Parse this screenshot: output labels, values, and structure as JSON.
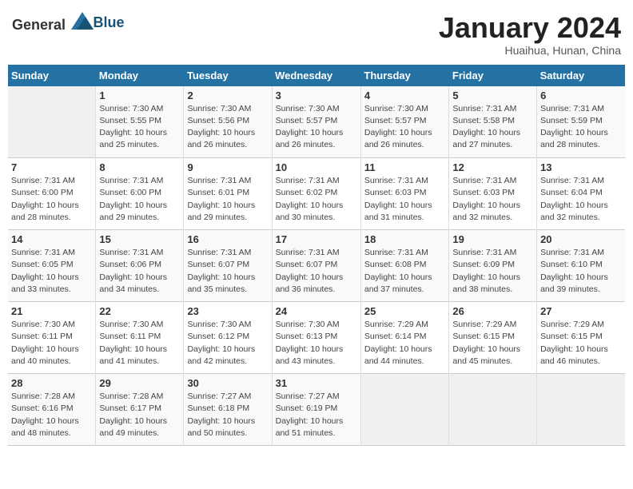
{
  "header": {
    "logo_general": "General",
    "logo_blue": "Blue",
    "month_title": "January 2024",
    "location": "Huaihua, Hunan, China"
  },
  "weekdays": [
    "Sunday",
    "Monday",
    "Tuesday",
    "Wednesday",
    "Thursday",
    "Friday",
    "Saturday"
  ],
  "weeks": [
    [
      {
        "day": "",
        "info": ""
      },
      {
        "day": "1",
        "info": "Sunrise: 7:30 AM\nSunset: 5:55 PM\nDaylight: 10 hours\nand 25 minutes."
      },
      {
        "day": "2",
        "info": "Sunrise: 7:30 AM\nSunset: 5:56 PM\nDaylight: 10 hours\nand 26 minutes."
      },
      {
        "day": "3",
        "info": "Sunrise: 7:30 AM\nSunset: 5:57 PM\nDaylight: 10 hours\nand 26 minutes."
      },
      {
        "day": "4",
        "info": "Sunrise: 7:30 AM\nSunset: 5:57 PM\nDaylight: 10 hours\nand 26 minutes."
      },
      {
        "day": "5",
        "info": "Sunrise: 7:31 AM\nSunset: 5:58 PM\nDaylight: 10 hours\nand 27 minutes."
      },
      {
        "day": "6",
        "info": "Sunrise: 7:31 AM\nSunset: 5:59 PM\nDaylight: 10 hours\nand 28 minutes."
      }
    ],
    [
      {
        "day": "7",
        "info": "Sunrise: 7:31 AM\nSunset: 6:00 PM\nDaylight: 10 hours\nand 28 minutes."
      },
      {
        "day": "8",
        "info": "Sunrise: 7:31 AM\nSunset: 6:00 PM\nDaylight: 10 hours\nand 29 minutes."
      },
      {
        "day": "9",
        "info": "Sunrise: 7:31 AM\nSunset: 6:01 PM\nDaylight: 10 hours\nand 29 minutes."
      },
      {
        "day": "10",
        "info": "Sunrise: 7:31 AM\nSunset: 6:02 PM\nDaylight: 10 hours\nand 30 minutes."
      },
      {
        "day": "11",
        "info": "Sunrise: 7:31 AM\nSunset: 6:03 PM\nDaylight: 10 hours\nand 31 minutes."
      },
      {
        "day": "12",
        "info": "Sunrise: 7:31 AM\nSunset: 6:03 PM\nDaylight: 10 hours\nand 32 minutes."
      },
      {
        "day": "13",
        "info": "Sunrise: 7:31 AM\nSunset: 6:04 PM\nDaylight: 10 hours\nand 32 minutes."
      }
    ],
    [
      {
        "day": "14",
        "info": "Sunrise: 7:31 AM\nSunset: 6:05 PM\nDaylight: 10 hours\nand 33 minutes."
      },
      {
        "day": "15",
        "info": "Sunrise: 7:31 AM\nSunset: 6:06 PM\nDaylight: 10 hours\nand 34 minutes."
      },
      {
        "day": "16",
        "info": "Sunrise: 7:31 AM\nSunset: 6:07 PM\nDaylight: 10 hours\nand 35 minutes."
      },
      {
        "day": "17",
        "info": "Sunrise: 7:31 AM\nSunset: 6:07 PM\nDaylight: 10 hours\nand 36 minutes."
      },
      {
        "day": "18",
        "info": "Sunrise: 7:31 AM\nSunset: 6:08 PM\nDaylight: 10 hours\nand 37 minutes."
      },
      {
        "day": "19",
        "info": "Sunrise: 7:31 AM\nSunset: 6:09 PM\nDaylight: 10 hours\nand 38 minutes."
      },
      {
        "day": "20",
        "info": "Sunrise: 7:31 AM\nSunset: 6:10 PM\nDaylight: 10 hours\nand 39 minutes."
      }
    ],
    [
      {
        "day": "21",
        "info": "Sunrise: 7:30 AM\nSunset: 6:11 PM\nDaylight: 10 hours\nand 40 minutes."
      },
      {
        "day": "22",
        "info": "Sunrise: 7:30 AM\nSunset: 6:11 PM\nDaylight: 10 hours\nand 41 minutes."
      },
      {
        "day": "23",
        "info": "Sunrise: 7:30 AM\nSunset: 6:12 PM\nDaylight: 10 hours\nand 42 minutes."
      },
      {
        "day": "24",
        "info": "Sunrise: 7:30 AM\nSunset: 6:13 PM\nDaylight: 10 hours\nand 43 minutes."
      },
      {
        "day": "25",
        "info": "Sunrise: 7:29 AM\nSunset: 6:14 PM\nDaylight: 10 hours\nand 44 minutes."
      },
      {
        "day": "26",
        "info": "Sunrise: 7:29 AM\nSunset: 6:15 PM\nDaylight: 10 hours\nand 45 minutes."
      },
      {
        "day": "27",
        "info": "Sunrise: 7:29 AM\nSunset: 6:15 PM\nDaylight: 10 hours\nand 46 minutes."
      }
    ],
    [
      {
        "day": "28",
        "info": "Sunrise: 7:28 AM\nSunset: 6:16 PM\nDaylight: 10 hours\nand 48 minutes."
      },
      {
        "day": "29",
        "info": "Sunrise: 7:28 AM\nSunset: 6:17 PM\nDaylight: 10 hours\nand 49 minutes."
      },
      {
        "day": "30",
        "info": "Sunrise: 7:27 AM\nSunset: 6:18 PM\nDaylight: 10 hours\nand 50 minutes."
      },
      {
        "day": "31",
        "info": "Sunrise: 7:27 AM\nSunset: 6:19 PM\nDaylight: 10 hours\nand 51 minutes."
      },
      {
        "day": "",
        "info": ""
      },
      {
        "day": "",
        "info": ""
      },
      {
        "day": "",
        "info": ""
      }
    ]
  ]
}
